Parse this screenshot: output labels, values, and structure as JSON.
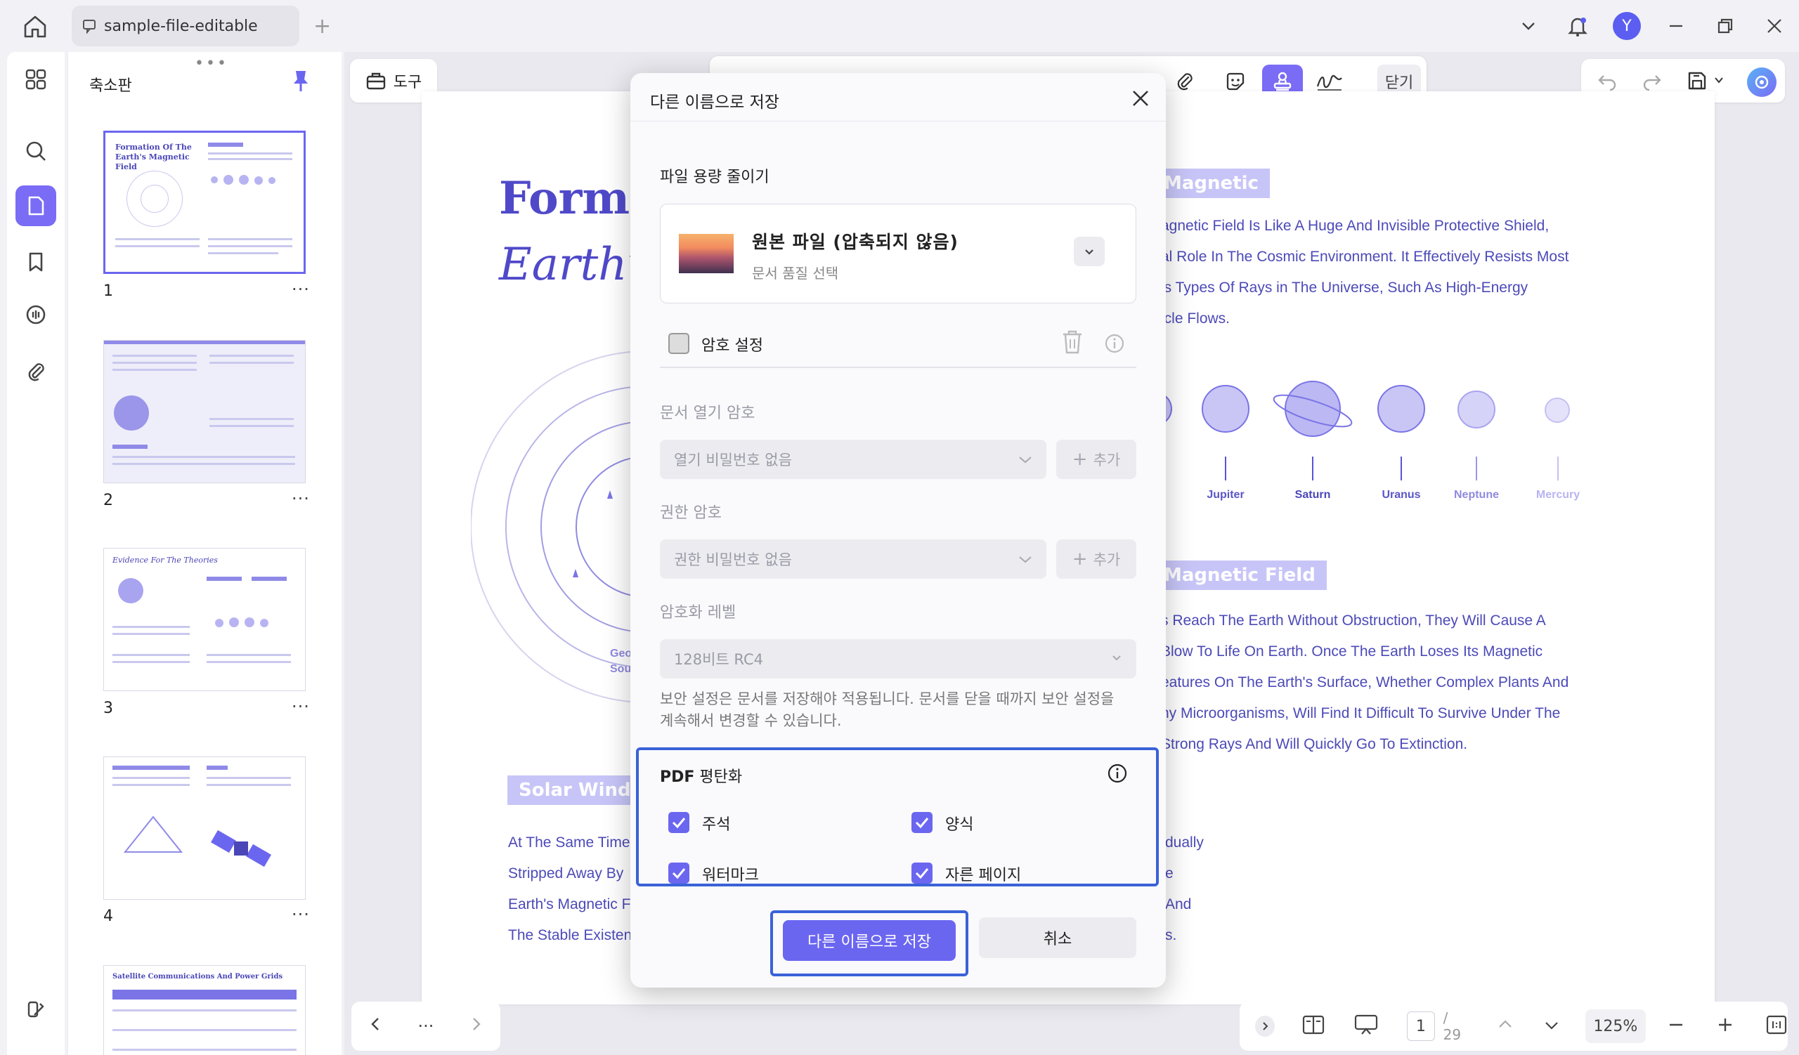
{
  "titlebar": {
    "tab_title": "sample-file-editable",
    "avatar_letter": "Y"
  },
  "thumbnails": {
    "title": "축소판",
    "pages": [
      {
        "number": "1",
        "mini_title": "Formation Of The Earth's Magnetic Field"
      },
      {
        "number": "2",
        "mini_title": ""
      },
      {
        "number": "3",
        "mini_title": "Evidence For The Theories"
      },
      {
        "number": "4",
        "mini_title": ""
      },
      {
        "number": "",
        "mini_title": "Satellite Communications And Power Grids"
      }
    ],
    "more": "···"
  },
  "toolbar": {
    "tool_label": "도구",
    "close_label": "닫기"
  },
  "document": {
    "title_line1": "Forma",
    "title_line2": "Earth’s",
    "tag_magnetic": "Magnetic",
    "tag_magnetic_field": "Magnetic Field",
    "tag_solar_wind": "Solar Wind",
    "para1": [
      "agnetic Field Is Like A Huge And Invisible Protective Shield,",
      "al Role In The Cosmic Environment. It Effectively Resists Most",
      "is Types Of Rays in The Universe, Such As High-Energy",
      "icle Flows."
    ],
    "para2": [
      "s Reach The Earth Without Obstruction, They Will Cause A",
      "Blow To Life On Earth. Once The Earth Loses Its Magnetic",
      "eatures On The Earth's Surface, Whether Complex Plants And",
      "ny Microorganisms, Will Find It Difficult To Survive Under The",
      "Strong Rays And Will Quickly Go To Extinction."
    ],
    "para3_left": [
      "At The Same Time",
      "Stripped Away By",
      "Earth's Magnetic F",
      "The Stable Existen"
    ],
    "para3_right": [
      "dually",
      "e",
      "And",
      "s."
    ],
    "orbit_caption": [
      "Geo",
      "Sou"
    ],
    "planets": [
      "Jupiter",
      "Saturn",
      "Uranus",
      "Neptune",
      "Mercury"
    ]
  },
  "dialog": {
    "title": "다른 이름으로 저장",
    "reduce_label": "파일 용량 줄이기",
    "quality_name": "원본 파일 (압축되지 않음)",
    "quality_sub": "문서 품질 선택",
    "password_label": "암호 설정",
    "open_pw_label": "문서 열기 암호",
    "open_pw_value": "열기 비밀번호 없음",
    "add_label": "추가",
    "perm_pw_label": "권한 암호",
    "perm_pw_value": "권한 비밀번호 없음",
    "enc_label": "암호화 레벨",
    "enc_value": "128비트 RC4",
    "note": "보안 설정은 문서를 저장해야 적용됩니다. 문서를 닫을 때까지 보안 설정을 계속해서 변경할 수 있습니다.",
    "flatten_title_pdf": "PDF",
    "flatten_title_rest": " 평탄화",
    "flatten_options": [
      {
        "label": "주석",
        "checked": true
      },
      {
        "label": "양식",
        "checked": true
      },
      {
        "label": "워터마크",
        "checked": true
      },
      {
        "label": "자른 페이지",
        "checked": true
      }
    ],
    "save_label": "다른 이름으로 저장",
    "cancel_label": "취소"
  },
  "bottom": {
    "more": "···",
    "current_page": "1",
    "total_pages": "/ 29",
    "zoom": "125%"
  },
  "colors": {
    "accent": "#6b66f0",
    "highlight_frame": "#3a62d8",
    "doc_text": "#4c4ab8"
  }
}
